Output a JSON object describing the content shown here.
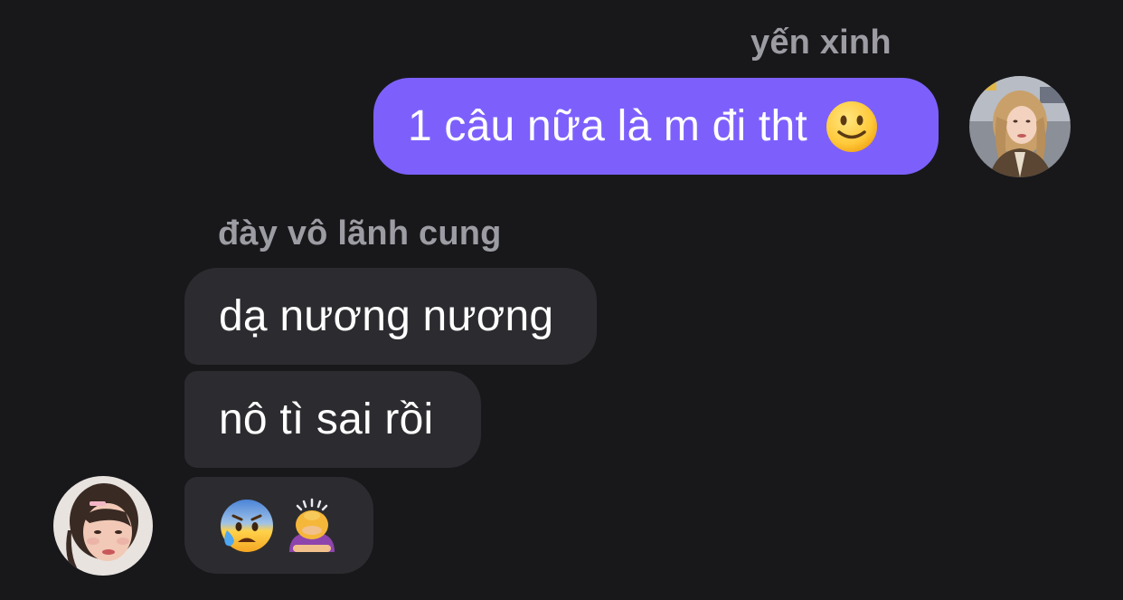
{
  "outgoing": {
    "sender_name": "yến xinh",
    "message_text": "1 câu nữa là m đi tht",
    "emoji": "slightly-smiling-face"
  },
  "incoming": {
    "sender_name": "đày vô lãnh cung",
    "messages": [
      {
        "text": "dạ nương nương"
      },
      {
        "text": "nô tì sai rồi"
      },
      {
        "emojis": [
          "anxious-face-with-sweat",
          "person-bowing"
        ]
      }
    ]
  },
  "colors": {
    "background": "#18181b",
    "outgoing_bubble": "#7d60fc",
    "incoming_bubble": "#2c2c30",
    "sender_name": "#9c9ca3",
    "message_text": "#ffffff"
  }
}
